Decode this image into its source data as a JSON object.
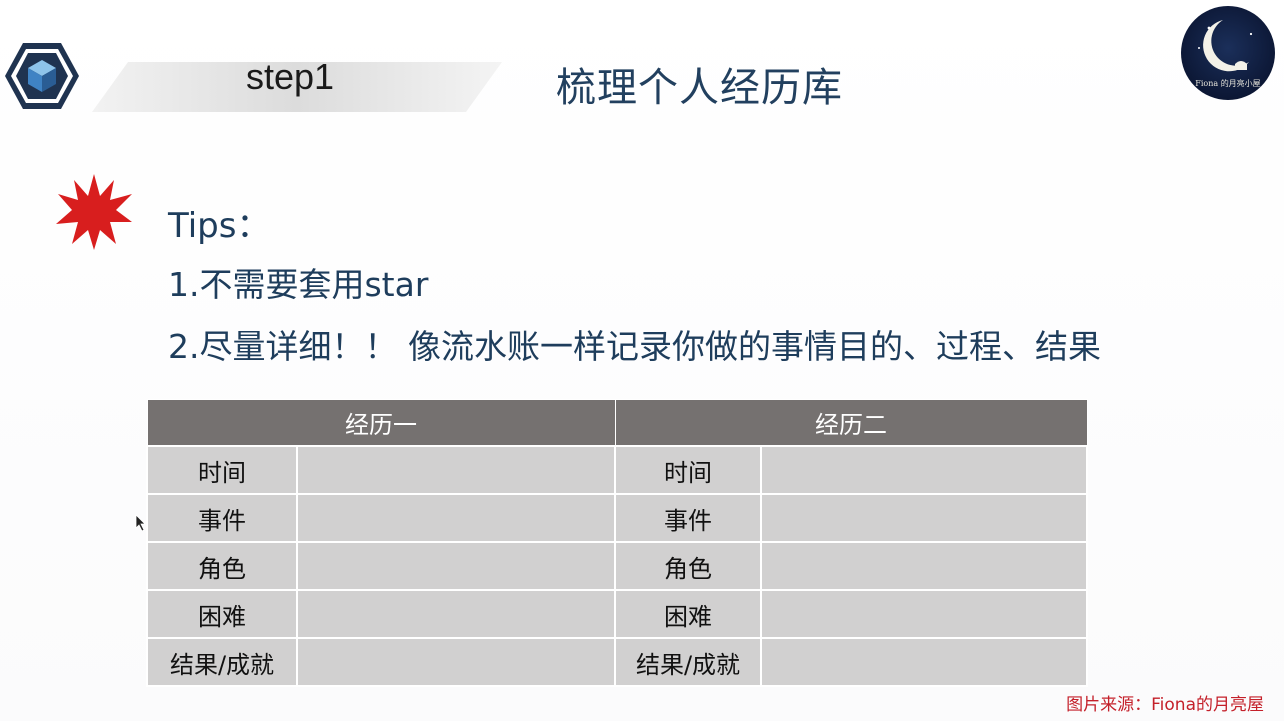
{
  "header": {
    "step_label": "step1",
    "title": "梳理个人经历库",
    "logo_icon": "hexagon-cube-icon",
    "badge": {
      "icon": "crescent-moon-icon",
      "text": "Fiona 的月亮小屋"
    }
  },
  "tips": {
    "icon": "red-burst-icon",
    "title": "Tips：",
    "items": [
      "1.不需要套用star",
      "2.尽量详细！！ 像流水账一样记录你做的事情目的、过程、结果"
    ]
  },
  "table": {
    "headers": [
      "经历一",
      "经历二"
    ],
    "rows": [
      {
        "left": "时间",
        "right": "时间"
      },
      {
        "left": "事件",
        "right": "事件"
      },
      {
        "left": "角色",
        "right": "角色"
      },
      {
        "left": "困难",
        "right": "困难"
      },
      {
        "left": "结果/成就",
        "right": "结果/成就"
      }
    ]
  },
  "footer": {
    "source": "图片来源：Fiona的月亮屋"
  },
  "colors": {
    "title": "#22405f",
    "tips_text": "#1e3d5c",
    "table_header": "#757170",
    "table_cell": "#d1d0d0",
    "burst": "#d81e1e",
    "source": "#c4202a"
  }
}
